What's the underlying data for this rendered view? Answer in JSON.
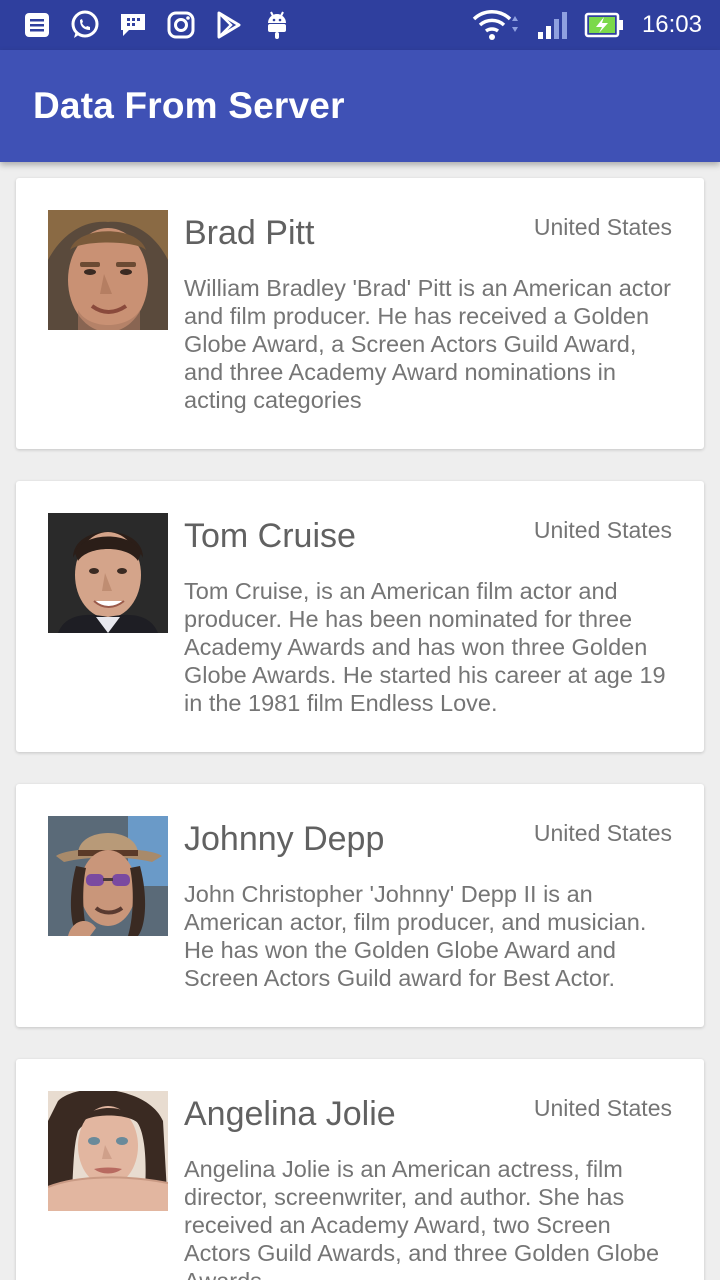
{
  "status_bar": {
    "time": "16:03",
    "notification_icons": [
      "list-icon",
      "whatsapp-icon",
      "bbm-icon",
      "instagram-icon",
      "play-store-icon",
      "android-icon"
    ],
    "system_icons": [
      "wifi-icon",
      "signal-icon",
      "battery-charging-icon"
    ]
  },
  "app_bar": {
    "title": "Data From Server"
  },
  "colors": {
    "status_bar": "#2f3f9e",
    "app_bar": "#3f51b5",
    "background": "#eeeeee",
    "card": "#ffffff",
    "text": "#757575"
  },
  "items": [
    {
      "name": "Brad Pitt",
      "country": "United States",
      "description": "William Bradley 'Brad' Pitt is an American actor and film producer. He has received a Golden Globe Award, a Screen Actors Guild Award, and three Academy Award nominations in acting categories"
    },
    {
      "name": "Tom Cruise",
      "country": "United States",
      "description": "Tom Cruise, is an American film actor and producer. He has been nominated for three Academy Awards and has won three Golden Globe Awards. He started his career at age 19 in the 1981 film Endless Love."
    },
    {
      "name": "Johnny Depp",
      "country": "United States",
      "description": "John Christopher 'Johnny' Depp II is an American actor, film producer, and musician. He has won the Golden Globe Award and Screen Actors Guild award for Best Actor."
    },
    {
      "name": "Angelina Jolie",
      "country": "United States",
      "description": "Angelina Jolie is an American actress, film director, screenwriter, and author. She has received an Academy Award, two Screen Actors Guild Awards, and three Golden Globe Awards."
    }
  ]
}
